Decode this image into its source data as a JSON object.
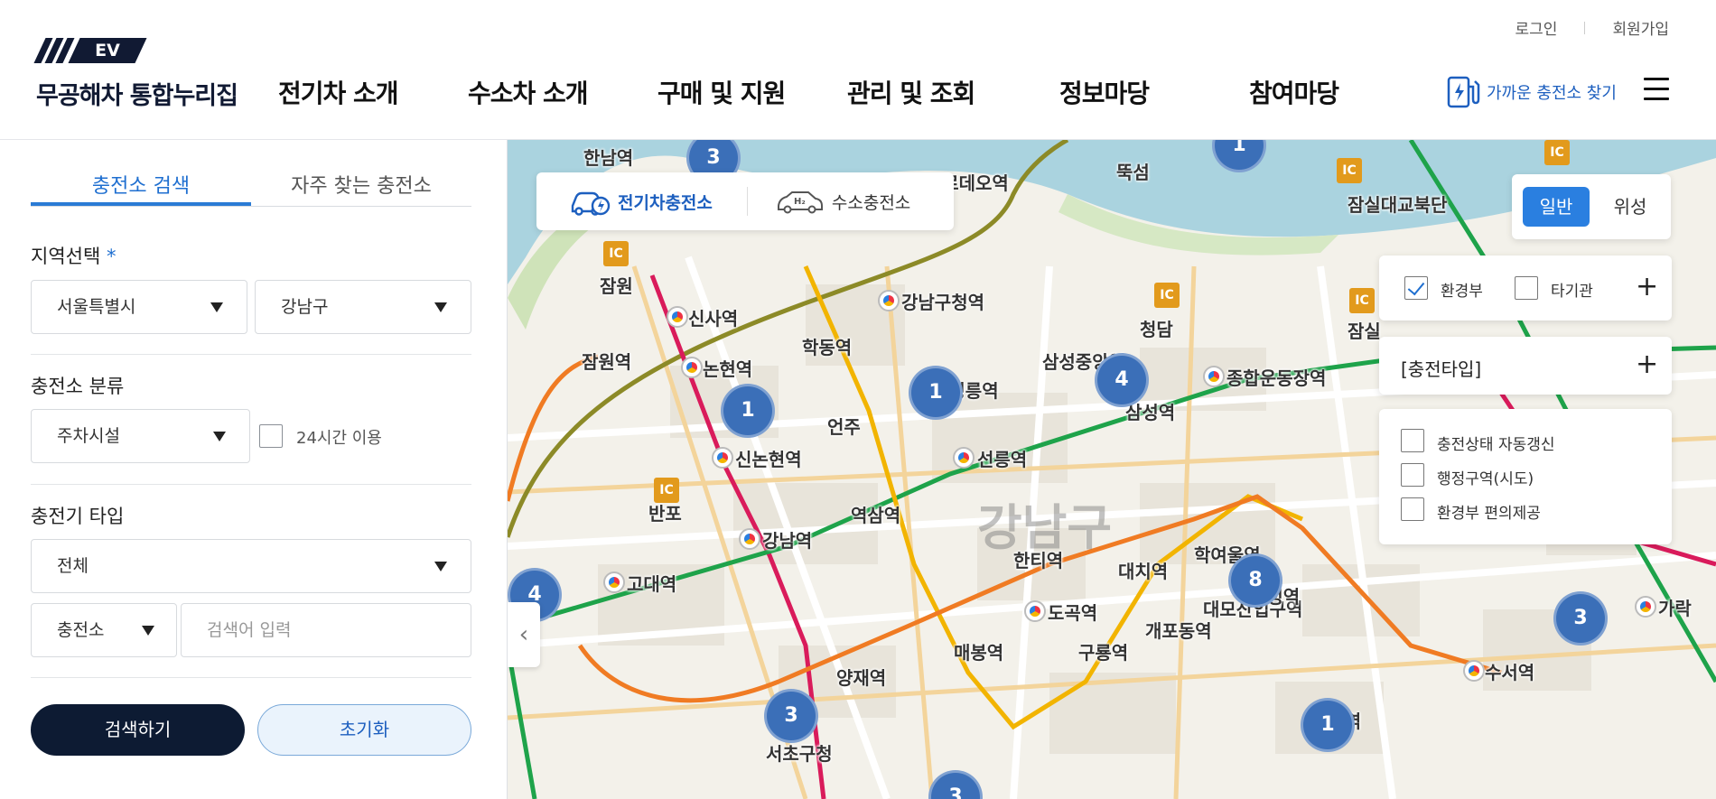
{
  "header": {
    "logo_badge": "EV",
    "logo_text": "무공해차 통합누리집",
    "util": {
      "login": "로그인",
      "signup": "회원가입"
    },
    "gnb": [
      "전기차 소개",
      "수소차 소개",
      "구매 및 지원",
      "관리 및 조회",
      "정보마당",
      "참여마당"
    ],
    "nearby_label": "가까운 충전소 찾기"
  },
  "sidebar": {
    "tabs": [
      "충전소 검색",
      "자주 찾는 충전소"
    ],
    "region": {
      "label": "지역선택",
      "required_mark": "*",
      "city": "서울특별시",
      "district": "강남구"
    },
    "category": {
      "label": "충전소 분류",
      "value": "주차시설",
      "checkbox_24h": "24시간 이용"
    },
    "charger_type": {
      "label": "충전기 타입",
      "value": "전체"
    },
    "search": {
      "scope": "충전소",
      "placeholder": "검색어 입력"
    },
    "btn_search": "검색하기",
    "btn_reset": "초기화"
  },
  "map": {
    "toggle": {
      "ev": "전기차충전소",
      "h2": "수소충전소"
    },
    "maptype": {
      "normal": "일반",
      "satellite": "위성"
    },
    "filter_org": {
      "ministry": "환경부",
      "ministry_checked": true,
      "other": "타기관",
      "other_checked": false
    },
    "filter_type": {
      "label": "[충전타입]"
    },
    "options": [
      "충전상태 자동갱신",
      "행정구역(시도)",
      "환경부 편의제공"
    ],
    "district_label": "강남구",
    "clusters": [
      "3",
      "1",
      "1",
      "1",
      "4",
      "4",
      "8",
      "3",
      "3",
      "1",
      "3"
    ],
    "station_labels": [
      "신사역",
      "논현역",
      "신논현역",
      "강남역",
      "강남구청역",
      "선정릉역",
      "선릉역",
      "삼성역",
      "종합운동장역",
      "고대역",
      "양재역",
      "도곡역",
      "한티역",
      "대치역",
      "학여울역",
      "대모산입구역",
      "개포동역",
      "구룡역",
      "매봉역",
      "수서역",
      "학동역",
      "언주",
      "역삼역",
      "삼성중앙역",
      "청담",
      "잠원역",
      "잠원",
      "반포",
      "서초구청",
      "뚝섬",
      "압구정로데오역",
      "한남역",
      "잠실대교북단",
      "잠실",
      "가락",
      "대청역",
      "일원역"
    ],
    "ic_label": "IC",
    "collapse_icon": "chevron-left-icon"
  }
}
